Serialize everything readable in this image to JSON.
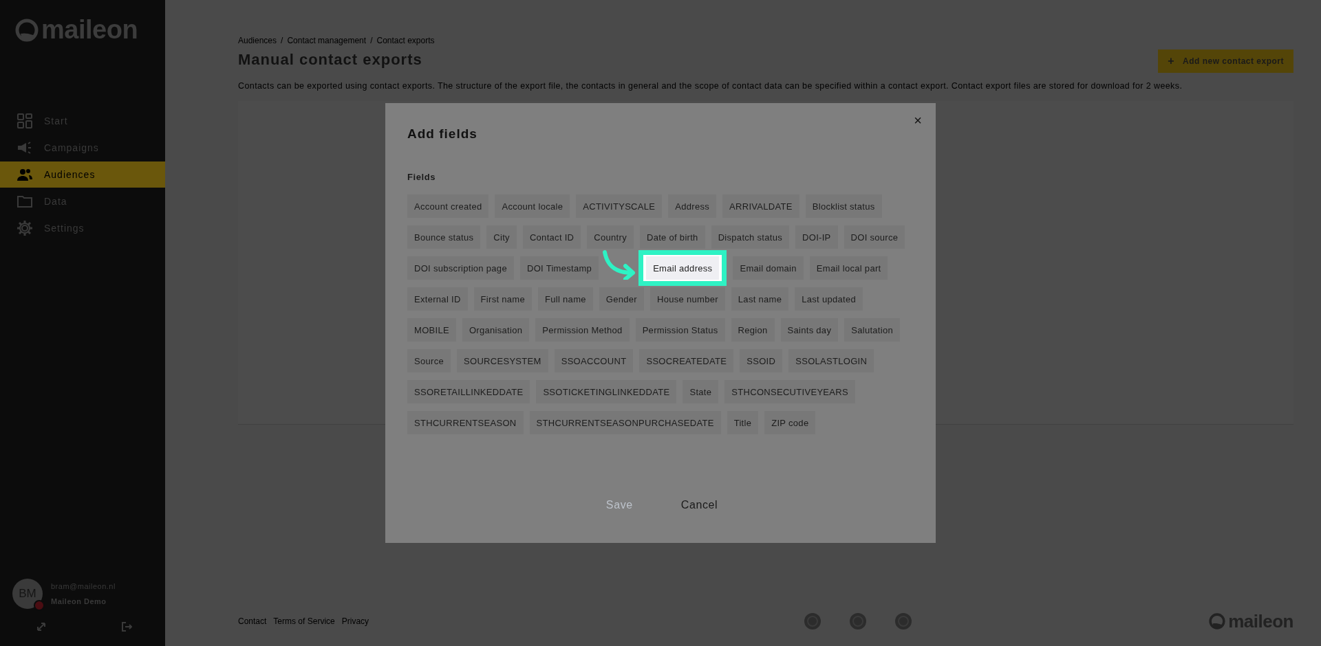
{
  "sidebar": {
    "logo": "maileon",
    "nav": [
      {
        "label": "Start",
        "selected": false
      },
      {
        "label": "Campaigns",
        "selected": false
      },
      {
        "label": "Audiences",
        "selected": true
      },
      {
        "label": "Data",
        "selected": false
      },
      {
        "label": "Settings",
        "selected": false
      }
    ],
    "user": {
      "initials": "BM",
      "email": "bram@maileon.nl",
      "account": "Maileon Demo"
    }
  },
  "breadcrumb": {
    "separator": "/",
    "items": [
      "Audiences",
      "Contact management",
      "Contact exports"
    ]
  },
  "page": {
    "title": "Manual contact exports",
    "add_button": {
      "icon": "+",
      "label": "Add new contact export"
    },
    "description": "Contacts can be exported using contact exports. The structure of the export file, the contacts in general and the scope of contact data can be specified within a contact export. Contact export files are stored for download for 2 weeks."
  },
  "footer": {
    "links": [
      "Contact",
      "Terms of Service",
      "Privacy"
    ],
    "logo": "maileon"
  },
  "modal": {
    "title": "Add fields",
    "close": "×",
    "section": "Fields",
    "fields": [
      {
        "label": "Account created",
        "highlighted": false
      },
      {
        "label": "Account locale",
        "highlighted": false
      },
      {
        "label": "ACTIVITYSCALE",
        "highlighted": false
      },
      {
        "label": "Address",
        "highlighted": false
      },
      {
        "label": "ARRIVALDATE",
        "highlighted": false
      },
      {
        "label": "Blocklist status",
        "highlighted": false
      },
      {
        "label": "Bounce status",
        "highlighted": false
      },
      {
        "label": "City",
        "highlighted": false
      },
      {
        "label": "Contact ID",
        "highlighted": false
      },
      {
        "label": "Country",
        "highlighted": false
      },
      {
        "label": "Date of birth",
        "highlighted": false
      },
      {
        "label": "Dispatch status",
        "highlighted": false
      },
      {
        "label": "DOI-IP",
        "highlighted": false
      },
      {
        "label": "DOI source",
        "highlighted": false
      },
      {
        "label": "DOI subscription page",
        "highlighted": false
      },
      {
        "label": "DOI Timestamp",
        "highlighted": false
      },
      {
        "label": "Email address",
        "highlighted": true
      },
      {
        "label": "Email domain",
        "highlighted": false
      },
      {
        "label": "Email local part",
        "highlighted": false
      },
      {
        "label": "External ID",
        "highlighted": false
      },
      {
        "label": "First name",
        "highlighted": false
      },
      {
        "label": "Full name",
        "highlighted": false
      },
      {
        "label": "Gender",
        "highlighted": false
      },
      {
        "label": "House number",
        "highlighted": false
      },
      {
        "label": "Last name",
        "highlighted": false
      },
      {
        "label": "Last updated",
        "highlighted": false
      },
      {
        "label": "MOBILE",
        "highlighted": false
      },
      {
        "label": "Organisation",
        "highlighted": false
      },
      {
        "label": "Permission Method",
        "highlighted": false
      },
      {
        "label": "Permission Status",
        "highlighted": false
      },
      {
        "label": "Region",
        "highlighted": false
      },
      {
        "label": "Saints day",
        "highlighted": false
      },
      {
        "label": "Salutation",
        "highlighted": false
      },
      {
        "label": "Source",
        "highlighted": false
      },
      {
        "label": "SOURCESYSTEM",
        "highlighted": false
      },
      {
        "label": "SSOACCOUNT",
        "highlighted": false
      },
      {
        "label": "SSOCREATEDATE",
        "highlighted": false
      },
      {
        "label": "SSOID",
        "highlighted": false
      },
      {
        "label": "SSOLASTLOGIN",
        "highlighted": false
      },
      {
        "label": "SSORETAILLINKEDDATE",
        "highlighted": false
      },
      {
        "label": "SSOTICKETINGLINKEDDATE",
        "highlighted": false
      },
      {
        "label": "State",
        "highlighted": false
      },
      {
        "label": "STHCONSECUTIVEYEARS",
        "highlighted": false
      },
      {
        "label": "STHCURRENTSEASON",
        "highlighted": false
      },
      {
        "label": "STHCURRENTSEASONPURCHASEDATE",
        "highlighted": false
      },
      {
        "label": "Title",
        "highlighted": false
      },
      {
        "label": "ZIP code",
        "highlighted": false
      }
    ],
    "buttons": [
      {
        "label": "Save",
        "disabled": true
      },
      {
        "label": "Cancel",
        "disabled": false
      }
    ]
  }
}
